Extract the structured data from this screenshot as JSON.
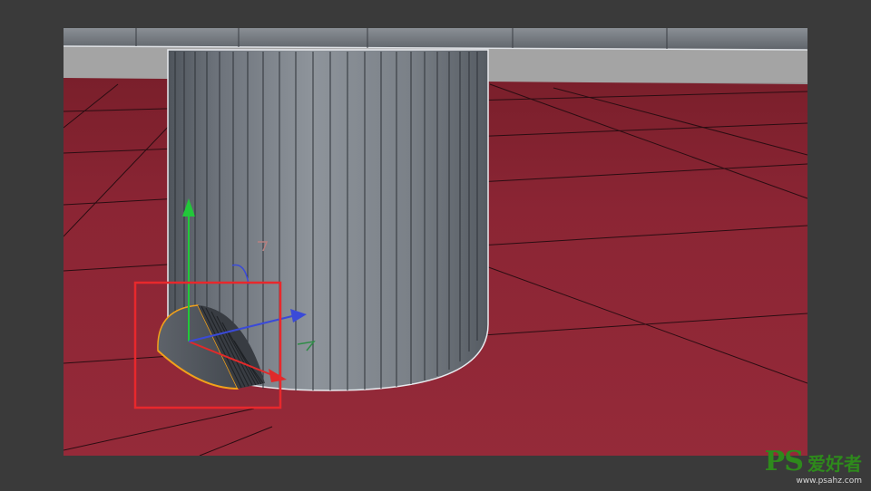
{
  "viewport": {
    "scene": "3d-editor-perspective-view",
    "floor_color": "#8e2836",
    "grid_line_color": "#2a0d12",
    "cylinder_color": "#8a9098",
    "tabletop_color": "#6d7279",
    "selection_box_color": "#e8282c",
    "gizmo": {
      "x_axis_color": "#e02a2a",
      "y_axis_color": "#22c83a",
      "z_axis_color": "#3a4ad8"
    },
    "selected_object": "half-cylinder"
  },
  "watermark": {
    "logo": "PS",
    "name": "爱好者",
    "url": "www.psahz.com",
    "color": "#2e8a1c"
  }
}
